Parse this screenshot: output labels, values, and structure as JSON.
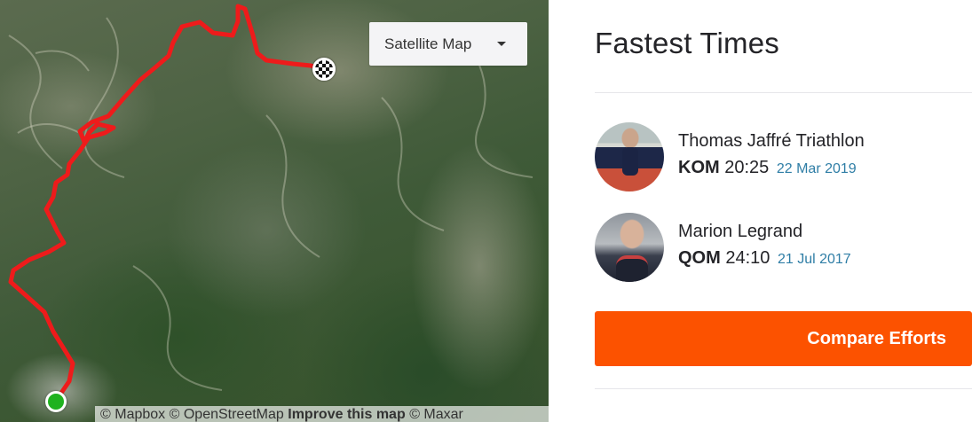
{
  "map": {
    "type_selector": "Satellite Map",
    "attribution": {
      "mapbox": "© Mapbox",
      "osm": "© OpenStreetMap",
      "improve": "Improve this map",
      "maxar": "© Maxar"
    },
    "route_color": "#ee1b1b",
    "start_icon": "start-marker-icon",
    "finish_icon": "checkered-flag-icon"
  },
  "leaderboard": {
    "title": "Fastest Times",
    "entries": [
      {
        "name": "Thomas Jaffré Triathlon",
        "badge": "KOM",
        "time": "20:25",
        "date": "22 Mar 2019"
      },
      {
        "name": "Marion Legrand",
        "badge": "QOM",
        "time": "24:10",
        "date": "21 Jul 2017"
      }
    ],
    "compare_button": "Compare Efforts",
    "accent_color": "#fc5200",
    "date_color": "#2f7ea6"
  }
}
